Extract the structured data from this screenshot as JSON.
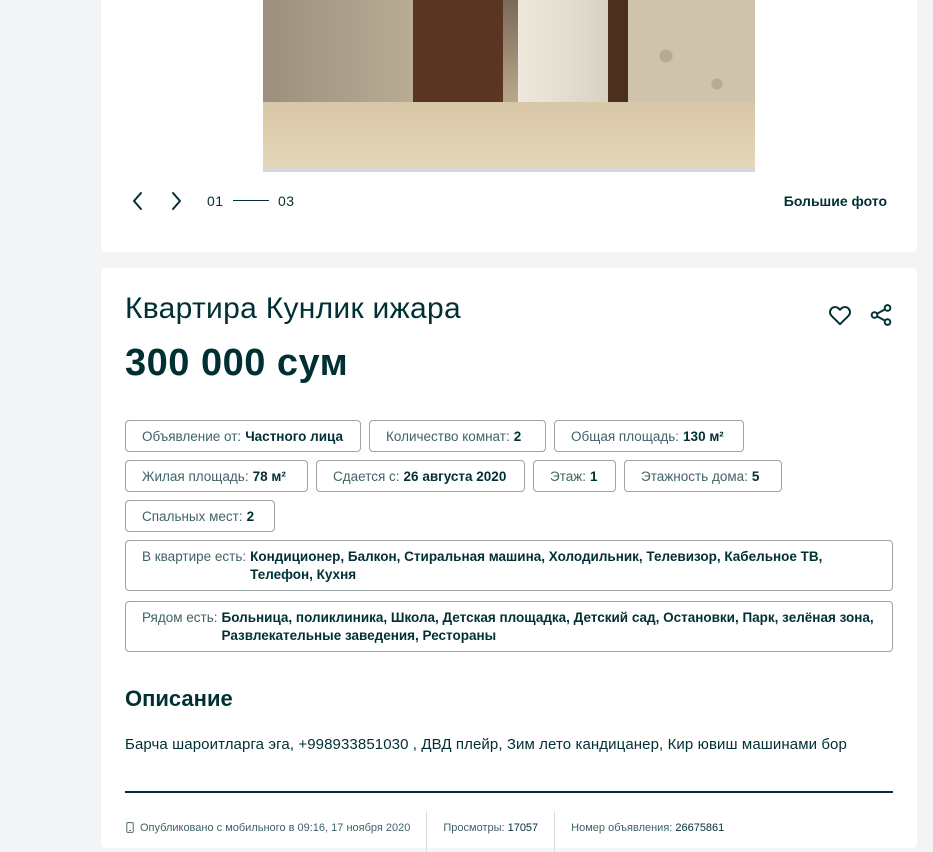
{
  "gallery": {
    "current": "01",
    "total": "03",
    "more_photos_label": "Большие фото"
  },
  "ad": {
    "title": "Квартира Кунлик ижара",
    "price": "300 000 сум"
  },
  "params": [
    {
      "label": "Объявление от:",
      "value": "Частного лица"
    },
    {
      "label": "Количество комнат:",
      "value": "2"
    },
    {
      "label": "Общая площадь:",
      "value": "130 м²"
    },
    {
      "label": "Жилая площадь:",
      "value": "78 м²"
    },
    {
      "label": "Сдается с:",
      "value": "26 августа 2020"
    },
    {
      "label": "Этаж:",
      "value": "1"
    },
    {
      "label": "Этажность дома:",
      "value": "5"
    },
    {
      "label": "Спальных мест:",
      "value": "2"
    }
  ],
  "amenities": {
    "label": "В квартире есть:",
    "value": "Кондиционер, Балкон, Стиральная машина, Холодильник, Телевизор, Кабельное ТВ, Телефон, Кухня"
  },
  "nearby": {
    "label": "Рядом есть:",
    "value": "Больница, поликлиника, Школа, Детская площадка, Детский сад, Остановки, Парк, зелёная зона, Развлекательные заведения, Рестораны"
  },
  "description": {
    "heading": "Описание",
    "text": "Барча шароитларга эга, +998933851030 , ДВД плейр, Зим лето кандицанер, Кир ювиш машинами бор"
  },
  "footer": {
    "published": "Опубликовано с мобильного в 09:16, 17 ноября 2020",
    "views_label": "Просмотры:",
    "views": "17057",
    "ad_number_label": "Номер объявления:",
    "ad_number": "26675861"
  },
  "icons": {
    "prev": "chevron-left-icon",
    "next": "chevron-right-icon",
    "favorite": "heart-icon",
    "share": "share-icon",
    "phone": "phone-icon"
  },
  "colors": {
    "text": "#002f34",
    "muted": "#406367",
    "border": "#9ba5a6",
    "background": "#f2f4f5"
  }
}
